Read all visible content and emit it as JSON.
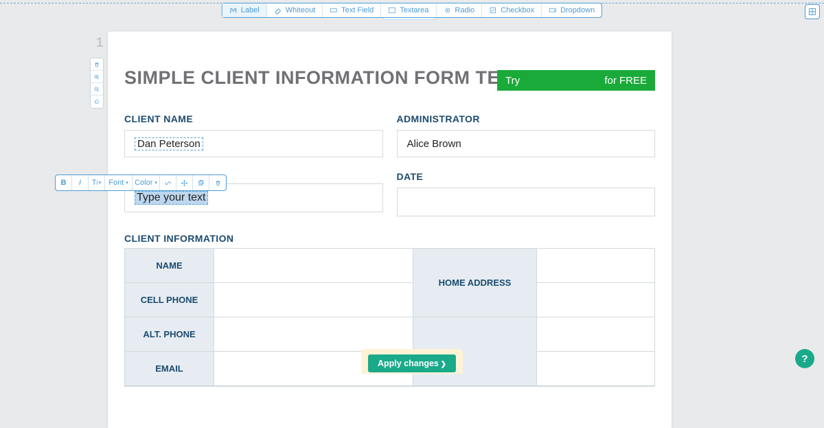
{
  "toolbar": {
    "items": [
      {
        "label": "Label",
        "active": true
      },
      {
        "label": "Whiteout"
      },
      {
        "label": "Text Field"
      },
      {
        "label": "Textarea"
      },
      {
        "label": "Radio"
      },
      {
        "label": "Checkbox"
      },
      {
        "label": "Dropdown"
      }
    ]
  },
  "page_number": "1",
  "doc": {
    "title": "SIMPLE CLIENT INFORMATION FORM TEMPLATE",
    "cta_prefix": "Try",
    "cta_suffix": "for FREE",
    "fields": {
      "client_name": {
        "label": "CLIENT NAME",
        "value": "Dan Peterson"
      },
      "administrator": {
        "label": "ADMINISTRATOR",
        "value": "Alice Brown"
      },
      "new_field": {
        "placeholder": "Type your text"
      },
      "date": {
        "label": "DATE",
        "value": ""
      }
    },
    "section_title": "CLIENT INFORMATION",
    "info_table": {
      "name": "NAME",
      "cell_phone": "CELL PHONE",
      "alt_phone": "ALT. PHONE",
      "email": "EMAIL",
      "home_address": "HOME ADDRESS"
    }
  },
  "float_toolbar": {
    "bold": "B",
    "italic": "I",
    "size": "T",
    "font": "Font",
    "color": "Color"
  },
  "apply_button": "Apply changes",
  "help": "?"
}
